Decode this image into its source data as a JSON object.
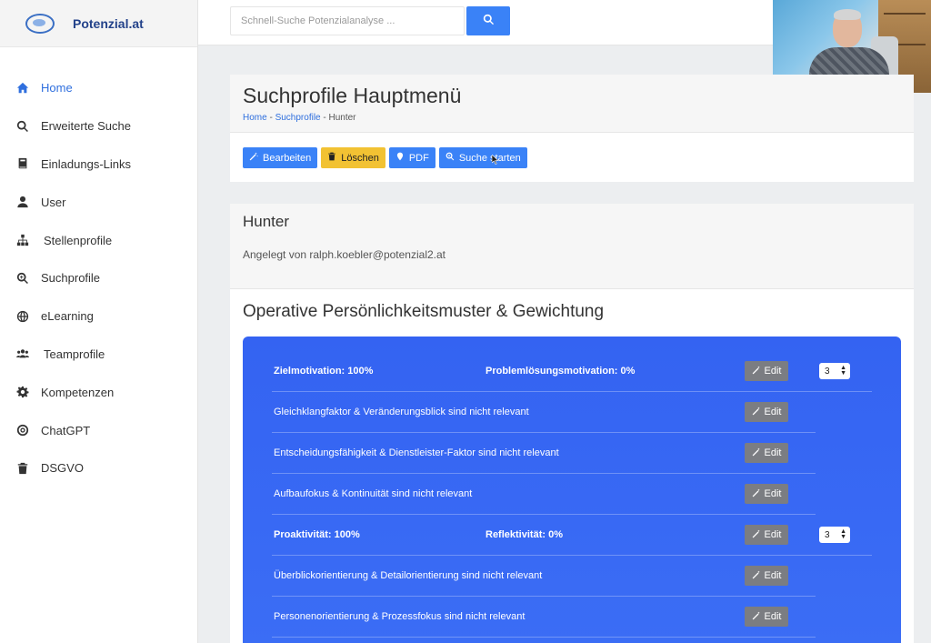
{
  "brand": {
    "name": "Potenzial.at"
  },
  "search": {
    "placeholder": "Schnell-Suche Potenzialanalyse ..."
  },
  "sidebar": {
    "items": [
      {
        "label": "Home",
        "icon": "home-icon",
        "active": true
      },
      {
        "label": "Erweiterte Suche",
        "icon": "search-icon"
      },
      {
        "label": "Einladungs-Links",
        "icon": "book-icon"
      },
      {
        "label": "User",
        "icon": "user-icon"
      },
      {
        "label": "Stellenprofile",
        "icon": "sitemap-icon"
      },
      {
        "label": "Suchprofile",
        "icon": "search-plus-icon"
      },
      {
        "label": "eLearning",
        "icon": "globe-icon"
      },
      {
        "label": "Teamprofile",
        "icon": "users-icon"
      },
      {
        "label": "Kompetenzen",
        "icon": "gear-icon"
      },
      {
        "label": "ChatGPT",
        "icon": "target-icon"
      },
      {
        "label": "DSGVO",
        "icon": "trash-icon"
      }
    ]
  },
  "header": {
    "title": "Suchprofile Hauptmenü",
    "breadcrumb": {
      "home": "Home",
      "sep1": " - ",
      "section": "Suchprofile",
      "sep2": " - ",
      "current": "Hunter"
    }
  },
  "toolbar": {
    "edit_label": "Bearbeiten",
    "delete_label": "Löschen",
    "pdf_label": "PDF",
    "start_label": "Suche starten"
  },
  "profile": {
    "name": "Hunter",
    "created_by": "Angelegt von ralph.koebler@potenzial2.at"
  },
  "section": {
    "title": "Operative Persönlichkeitsmuster & Gewichtung"
  },
  "rows": [
    {
      "type": "header",
      "left": "Zielmotivation: 100%",
      "right": "Problemlösungsmotivation: 0%",
      "edit": "Edit",
      "weight": "3"
    },
    {
      "type": "item",
      "text": "Gleichklangfaktor & Veränderungsblick sind nicht relevant",
      "edit": "Edit"
    },
    {
      "type": "item",
      "text": "Entscheidungsfähigkeit & Dienstleister-Faktor sind nicht relevant",
      "edit": "Edit"
    },
    {
      "type": "item",
      "text": "Aufbaufokus & Kontinuität sind nicht relevant",
      "edit": "Edit"
    },
    {
      "type": "header",
      "left": "Proaktivität: 100%",
      "right": "Reflektivität: 0%",
      "edit": "Edit",
      "weight": "3"
    },
    {
      "type": "item",
      "text": "Überblickorientierung & Detailorientierung sind nicht relevant",
      "edit": "Edit"
    },
    {
      "type": "item",
      "text": "Personenorientierung & Prozessfokus sind nicht relevant",
      "edit": "Edit"
    }
  ],
  "colors": {
    "primary": "#3a82f7",
    "warning": "#f2c233",
    "card": "#3463f2",
    "edit": "#7b7d82",
    "active": "#2f6fde"
  }
}
